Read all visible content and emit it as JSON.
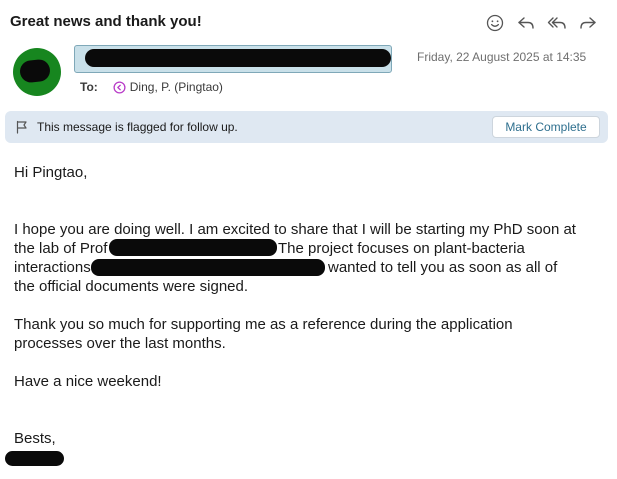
{
  "email": {
    "subject": "Great news and thank you!",
    "date": "Friday, 22 August 2025 at 14:35",
    "to_label": "To:",
    "recipient": "Ding, P. (Pingtao)"
  },
  "toolbar": {
    "actions": [
      {
        "name": "emoji-react",
        "icon": "smiley-icon"
      },
      {
        "name": "reply",
        "icon": "reply-icon"
      },
      {
        "name": "reply-all",
        "icon": "reply-all-icon"
      },
      {
        "name": "forward",
        "icon": "forward-icon"
      }
    ]
  },
  "flag_banner": {
    "message": "This message is flagged for follow up.",
    "button_label": "Mark Complete"
  },
  "body": {
    "greeting": "Hi Pingtao,",
    "p1_line1": "I hope you are doing well. I am excited to share that I will be starting my PhD soon at",
    "p1_line2_a": "the lab of Prof",
    "p1_line2_b": "The project focuses on plant-bacteria",
    "p1_line3_a": "interactions",
    "p1_line3_b": "wanted to tell you as soon as all of",
    "p1_line4": "the official documents were signed.",
    "p2_line1": "Thank you so much for supporting me as a reference during the application",
    "p2_line2": "processes over the last months.",
    "p3": "Have a nice weekend!",
    "closing": "Bests,"
  },
  "colors": {
    "avatar": "#17861f",
    "sender_highlight": "#c9e0e9",
    "flag_banner": "#dfe8f2",
    "accent_link": "#2e6f8e",
    "recipient_icon": "#b83cc8"
  }
}
